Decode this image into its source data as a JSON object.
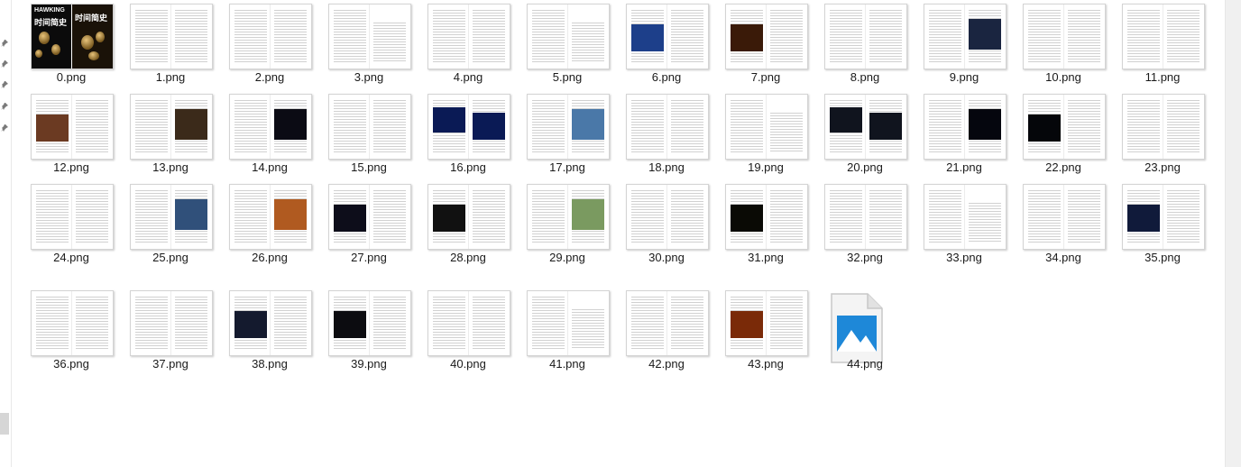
{
  "files": [
    {
      "name": "0.png",
      "kind": "cover"
    },
    {
      "name": "1.png",
      "kind": "text"
    },
    {
      "name": "2.png",
      "kind": "text"
    },
    {
      "name": "3.png",
      "kind": "toc"
    },
    {
      "name": "4.png",
      "kind": "text"
    },
    {
      "name": "5.png",
      "kind": "text"
    },
    {
      "name": "6.png",
      "kind": "photo-left",
      "color": "#1d3f8a"
    },
    {
      "name": "7.png",
      "kind": "photo-left",
      "color": "#3a1a08"
    },
    {
      "name": "8.png",
      "kind": "text"
    },
    {
      "name": "9.png",
      "kind": "photo-right",
      "color": "#1a2540"
    },
    {
      "name": "10.png",
      "kind": "text"
    },
    {
      "name": "11.png",
      "kind": "text"
    },
    {
      "name": "12.png",
      "kind": "photo-left",
      "color": "#6b3a22"
    },
    {
      "name": "13.png",
      "kind": "photo-right",
      "color": "#3b2a1a"
    },
    {
      "name": "14.png",
      "kind": "photo-right",
      "color": "#0b0b14"
    },
    {
      "name": "15.png",
      "kind": "text"
    },
    {
      "name": "16.png",
      "kind": "photo-both",
      "color": "#0a1a55"
    },
    {
      "name": "17.png",
      "kind": "photo-right",
      "color": "#4a78a8"
    },
    {
      "name": "18.png",
      "kind": "text"
    },
    {
      "name": "19.png",
      "kind": "text"
    },
    {
      "name": "20.png",
      "kind": "photo-both",
      "color": "#10141e"
    },
    {
      "name": "21.png",
      "kind": "photo-right",
      "color": "#05060e"
    },
    {
      "name": "22.png",
      "kind": "photo-left",
      "color": "#05060a"
    },
    {
      "name": "23.png",
      "kind": "text"
    },
    {
      "name": "24.png",
      "kind": "text"
    },
    {
      "name": "25.png",
      "kind": "photo-right",
      "color": "#30507a"
    },
    {
      "name": "26.png",
      "kind": "photo-right",
      "color": "#b05a20"
    },
    {
      "name": "27.png",
      "kind": "photo-left",
      "color": "#0d0d1a"
    },
    {
      "name": "28.png",
      "kind": "photo-left",
      "color": "#111111"
    },
    {
      "name": "29.png",
      "kind": "photo-right",
      "color": "#7a9a60"
    },
    {
      "name": "30.png",
      "kind": "text"
    },
    {
      "name": "31.png",
      "kind": "photo-left",
      "color": "#0a0a05"
    },
    {
      "name": "32.png",
      "kind": "text"
    },
    {
      "name": "33.png",
      "kind": "text"
    },
    {
      "name": "34.png",
      "kind": "text"
    },
    {
      "name": "35.png",
      "kind": "photo-left",
      "color": "#101a3a"
    },
    {
      "name": "36.png",
      "kind": "text"
    },
    {
      "name": "37.png",
      "kind": "text"
    },
    {
      "name": "38.png",
      "kind": "photo-left",
      "color": "#141a2e"
    },
    {
      "name": "39.png",
      "kind": "photo-left",
      "color": "#0c0c10"
    },
    {
      "name": "40.png",
      "kind": "text"
    },
    {
      "name": "41.png",
      "kind": "text"
    },
    {
      "name": "42.png",
      "kind": "text"
    },
    {
      "name": "43.png",
      "kind": "photo-left",
      "color": "#7a2a08"
    },
    {
      "name": "44.png",
      "kind": "generic-image-icon"
    }
  ],
  "cover": {
    "author": "HAWKING",
    "title": "时间简史"
  },
  "colors": {
    "accent": "#1e88d8",
    "selection": "#cce8ff"
  }
}
